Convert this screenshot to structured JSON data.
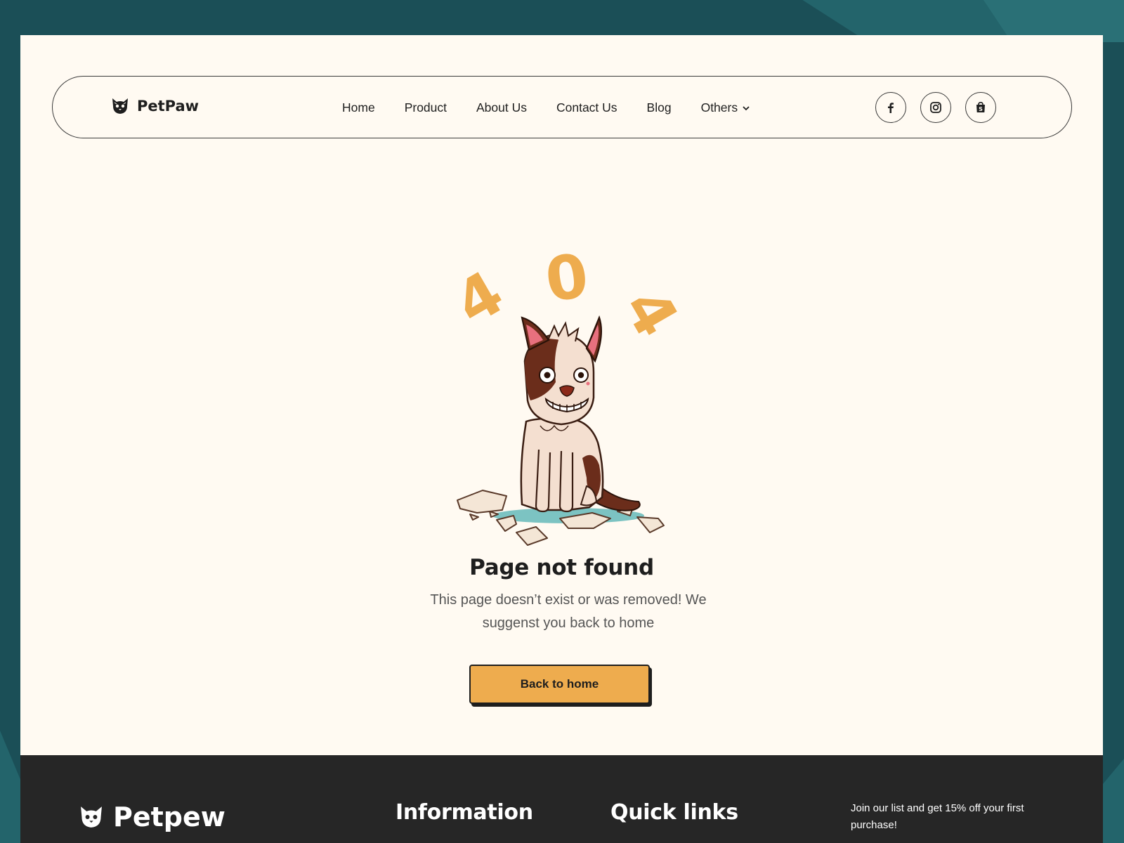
{
  "brand": {
    "name": "PetPaw",
    "footer_name": "Petpew",
    "logo_icon": "cat-face-icon"
  },
  "nav": {
    "items": [
      {
        "label": "Home"
      },
      {
        "label": "Product"
      },
      {
        "label": "About Us"
      },
      {
        "label": "Contact Us"
      },
      {
        "label": "Blog"
      },
      {
        "label": "Others",
        "has_dropdown": true
      }
    ],
    "socials": [
      "facebook-icon",
      "instagram-icon",
      "shopify-bag-icon"
    ]
  },
  "error": {
    "code_digits": [
      "4",
      "0",
      "4"
    ],
    "title": "Page not found",
    "description": "This page doesn’t exist or was removed! We suggenst you back to home",
    "button_label": "Back to home"
  },
  "footer": {
    "information_heading": "Information",
    "quick_links_heading": "Quick links",
    "newsletter_text": "Join our list and get 15% off your first purchase!"
  },
  "colors": {
    "accent": "#eeac4e",
    "page_bg": "#fffaf2",
    "outer_bg": "#1b4f57",
    "footer_bg": "#262626",
    "text_dark": "#1e1e1e"
  }
}
